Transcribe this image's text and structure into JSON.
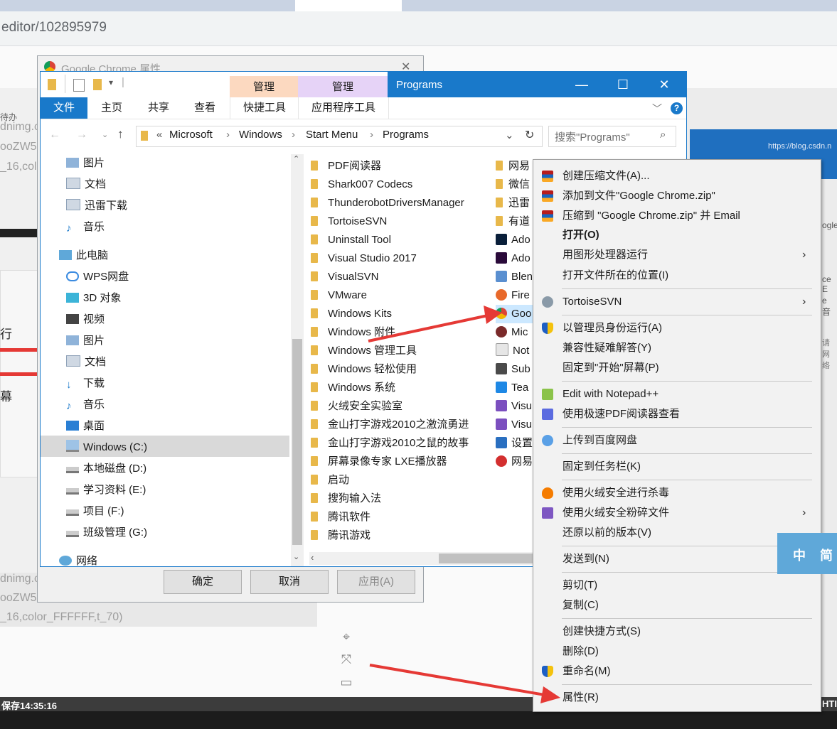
{
  "browser": {
    "url": "editor/102895979",
    "bg_texts": [
      "dnimg.c",
      "ooZW5",
      "_16,col",
      "待办",
      "dnimg.c",
      "ooZW5",
      "_16,color_FFFFFF,t_70)",
      "行",
      "幕",
      "https://blog.csdn.n",
      "ogle",
      "ce E",
      "e 音",
      "请网络"
    ],
    "status_text": "保存14:35:16",
    "status_right": "HTI"
  },
  "properties_dialog": {
    "title": "Google Chrome 属性",
    "ok": "确定",
    "cancel": "取消",
    "apply": "应用(A)"
  },
  "explorer": {
    "manage_tab_1": "管理",
    "manage_tab_2": "管理",
    "window_title": "Programs",
    "ribbon_tabs": [
      "文件",
      "主页",
      "共享",
      "查看",
      "快捷工具",
      "应用程序工具"
    ],
    "breadcrumb": [
      "Microsoft",
      "Windows",
      "Start Menu",
      "Programs"
    ],
    "breadcrumb_prefix": "«",
    "search_placeholder": "搜索\"Programs\"",
    "nav_items": [
      "图片",
      "文档",
      "迅雷下载",
      "音乐",
      "此电脑",
      "WPS网盘",
      "3D 对象",
      "视频",
      "图片",
      "文档",
      "下载",
      "音乐",
      "桌面",
      "Windows (C:)",
      "本地磁盘 (D:)",
      "学习资料 (E:)",
      "项目 (F:)",
      "班级管理 (G:)",
      "网络"
    ],
    "files": [
      "PDF阅读器",
      "Shark007 Codecs",
      "ThunderobotDriversManager",
      "TortoiseSVN",
      "Uninstall Tool",
      "Visual Studio 2017",
      "VisualSVN",
      "VMware",
      "Windows Kits",
      "Windows 附件",
      "Windows 管理工具",
      "Windows 轻松使用",
      "Windows 系统",
      "火绒安全实验室",
      "金山打字游戏2010之激流勇进",
      "金山打字游戏2010之鼠的故事",
      "屏幕录像专家 LXE播放器",
      "启动",
      "搜狗输入法",
      "腾讯软件",
      "腾讯游戏"
    ],
    "files_col2": [
      "网易",
      "微信",
      "迅雷",
      "有道",
      "Ado",
      "Ado",
      "Blen",
      "Fire",
      "Goo",
      "Mic",
      "Not",
      "Sub",
      "Tea",
      "Visu",
      "Visu",
      "设置",
      "网易"
    ]
  },
  "context_menu": {
    "items": [
      {
        "label": "创建压缩文件(A)...",
        "icon": "winrar-icon"
      },
      {
        "label": "添加到文件\"Google Chrome.zip\"",
        "icon": "winrar-icon"
      },
      {
        "label": "压缩到 \"Google Chrome.zip\" 并 Email",
        "icon": "winrar-icon"
      },
      {
        "label": "打开(O)",
        "icon": "",
        "bold": true
      },
      {
        "label": "用图形处理器运行",
        "icon": "",
        "submenu": true
      },
      {
        "label": "打开文件所在的位置(I)",
        "icon": ""
      },
      {
        "label": "TortoiseSVN",
        "icon": "tortoise-icon",
        "submenu": true
      },
      {
        "label": "以管理员身份运行(A)",
        "icon": "shield-icon"
      },
      {
        "label": "兼容性疑难解答(Y)",
        "icon": ""
      },
      {
        "label": "固定到\"开始\"屏幕(P)",
        "icon": ""
      },
      {
        "label": "Edit with Notepad++",
        "icon": "notepad-icon"
      },
      {
        "label": "使用极速PDF阅读器查看",
        "icon": "pdf-icon"
      },
      {
        "label": "上传到百度网盘",
        "icon": "baidu-cloud-icon"
      },
      {
        "label": "固定到任务栏(K)",
        "icon": ""
      },
      {
        "label": "使用火绒安全进行杀毒",
        "icon": "huorong-icon"
      },
      {
        "label": "使用火绒安全粉碎文件",
        "icon": "shredder-icon",
        "submenu": true
      },
      {
        "label": "还原以前的版本(V)",
        "icon": ""
      },
      {
        "label": "发送到(N)",
        "icon": "",
        "submenu": true
      },
      {
        "label": "剪切(T)",
        "icon": ""
      },
      {
        "label": "复制(C)",
        "icon": ""
      },
      {
        "label": "创建快捷方式(S)",
        "icon": ""
      },
      {
        "label": "删除(D)",
        "icon": ""
      },
      {
        "label": "重命名(M)",
        "icon": "shield-icon"
      },
      {
        "label": "属性(R)",
        "icon": ""
      }
    ]
  },
  "language_widget": {
    "zh": "中",
    "simplified": "简"
  },
  "colors": {
    "accent": "#1979ca",
    "arrow": "#e53935",
    "folder": "#e8b84a"
  }
}
